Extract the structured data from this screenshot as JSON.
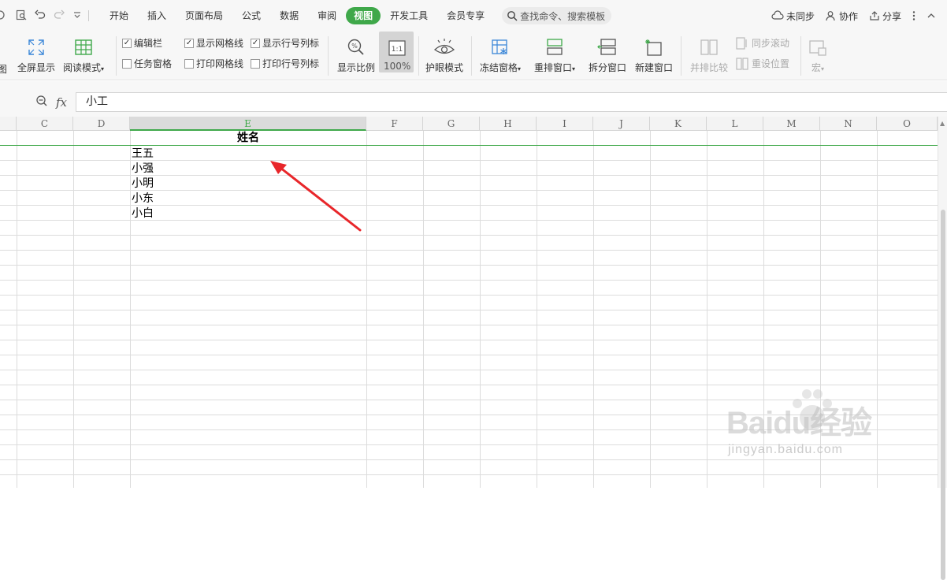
{
  "menubar": {
    "tabs": [
      {
        "label": "开始",
        "active": false
      },
      {
        "label": "插入",
        "active": false
      },
      {
        "label": "页面布局",
        "active": false
      },
      {
        "label": "公式",
        "active": false
      },
      {
        "label": "数据",
        "active": false
      },
      {
        "label": "审阅",
        "active": false
      },
      {
        "label": "视图",
        "active": true
      },
      {
        "label": "开发工具",
        "active": false
      },
      {
        "label": "会员专享",
        "active": false
      }
    ],
    "search_placeholder": "查找命令、搜索模板",
    "right": {
      "sync": "未同步",
      "collab": "协作",
      "share": "分享"
    }
  },
  "ribbon": {
    "partial_label": "图",
    "fullscreen": "全屏显示",
    "reading_mode": "阅读模式",
    "checkboxes": {
      "edit_bar": {
        "label": "编辑栏",
        "checked": true
      },
      "task_pane": {
        "label": "任务窗格",
        "checked": false
      },
      "show_gridlines": {
        "label": "显示网格线",
        "checked": true
      },
      "print_gridlines": {
        "label": "打印网格线",
        "checked": false
      },
      "show_headers": {
        "label": "显示行号列标",
        "checked": true
      },
      "print_headers": {
        "label": "打印行号列标",
        "checked": false
      }
    },
    "zoom_ratio": "显示比例",
    "zoom_100": "100%",
    "zoom_100_icon_text": "1:1",
    "eye_mode": "护眼模式",
    "freeze": "冻结窗格",
    "arrange": "重排窗口",
    "split": "拆分窗口",
    "new_window": "新建窗口",
    "side_by_side": "并排比较",
    "sync_scroll": "同步滚动",
    "reset_position": "重设位置",
    "macro": "宏"
  },
  "formula_bar": {
    "fx_label": "fx",
    "value": "小工"
  },
  "grid": {
    "columns": [
      "C",
      "D",
      "E",
      "F",
      "G",
      "H",
      "I",
      "J",
      "K",
      "L",
      "M",
      "N",
      "O"
    ],
    "selected_column": "E",
    "header": "姓名",
    "names": [
      "王五",
      "小强",
      "小明",
      "小东",
      "小白"
    ]
  },
  "watermark": {
    "brand": "Baidu经验",
    "url": "jingyan.baidu.com"
  },
  "colors": {
    "accent": "#3fa84a",
    "arrow": "#e8262a"
  }
}
